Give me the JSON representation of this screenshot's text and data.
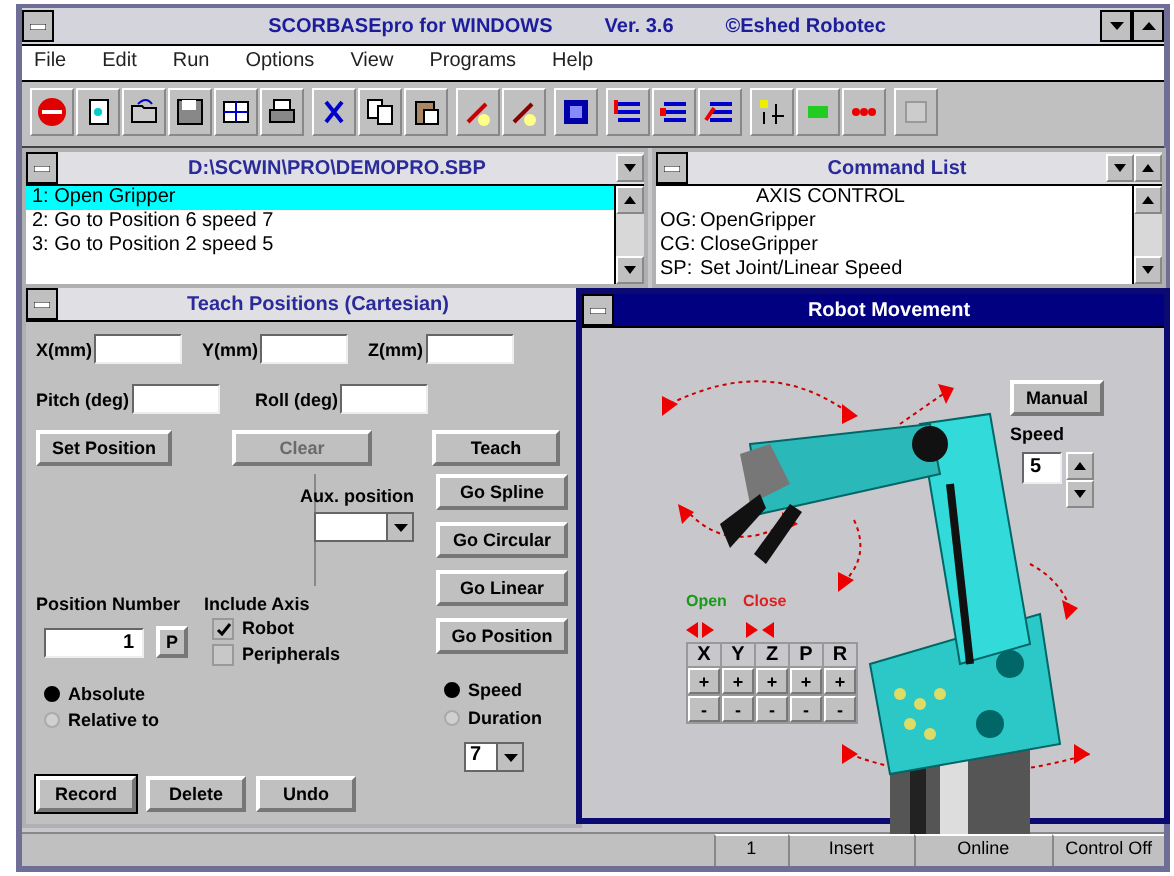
{
  "window": {
    "title": "SCORBASEpro for WINDOWS",
    "version": "Ver. 3.6",
    "copyright": "©Eshed Robotec"
  },
  "menu": [
    "File",
    "Edit",
    "Run",
    "Options",
    "View",
    "Programs",
    "Help"
  ],
  "program_window": {
    "title": "D:\\SCWIN\\PRO\\DEMOPRO.SBP",
    "rows": [
      {
        "text": "1: Open Gripper",
        "selected": true
      },
      {
        "text": "2: Go to Position  6  speed  7",
        "selected": false
      },
      {
        "text": "3: Go to Position  2  speed  5",
        "selected": false
      }
    ]
  },
  "command_list": {
    "title": "Command  List",
    "rows": [
      {
        "code": "",
        "text": "AXIS  CONTROL"
      },
      {
        "code": "OG:",
        "text": "OpenGripper"
      },
      {
        "code": "CG:",
        "text": "CloseGripper"
      },
      {
        "code": "SP:",
        "text": "Set Joint/Linear Speed"
      }
    ]
  },
  "teach_positions": {
    "title": "Teach Positions  (Cartesian)",
    "fields": [
      {
        "label": "X(mm)"
      },
      {
        "label": "Y(mm)"
      },
      {
        "label": "Z(mm)"
      },
      {
        "label": "Pitch (deg)"
      },
      {
        "label": "Roll (deg)"
      }
    ],
    "buttons": [
      {
        "label": "Set Position",
        "disabled": false
      },
      {
        "label": "Clear",
        "disabled": true
      },
      {
        "label": "Teach",
        "disabled": false
      }
    ],
    "aux_position": {
      "label": "Aux. position"
    },
    "go_buttons": [
      "Go Spline",
      "Go Circular",
      "Go Linear",
      "Go Position"
    ],
    "position_number": {
      "label": "Position Number",
      "value": "1",
      "button": "P"
    },
    "include_axis": {
      "label": "Include Axis",
      "items": [
        {
          "label": "Robot",
          "checked": true
        },
        {
          "label": "Peripherals",
          "checked": false
        }
      ]
    },
    "reference": [
      {
        "label": "Absolute",
        "selected": true
      },
      {
        "label": "Relative to",
        "selected": false
      }
    ],
    "motion": [
      {
        "label": "Speed",
        "selected": true
      },
      {
        "label": "Duration",
        "selected": false
      }
    ],
    "motion_value": "7",
    "bottom_buttons": [
      "Record",
      "Delete",
      "Undo"
    ]
  },
  "robot_movement": {
    "title": "Robot Movement",
    "active": true,
    "manual": "Manual",
    "speed_label": "Speed",
    "speed_value": "5",
    "open": "Open",
    "close": "Close",
    "axes": [
      "X",
      "Y",
      "Z",
      "P",
      "R"
    ],
    "plus": "+",
    "minus": "-"
  },
  "status_bar": [
    "1",
    "Insert",
    "Online",
    "Control Off"
  ]
}
